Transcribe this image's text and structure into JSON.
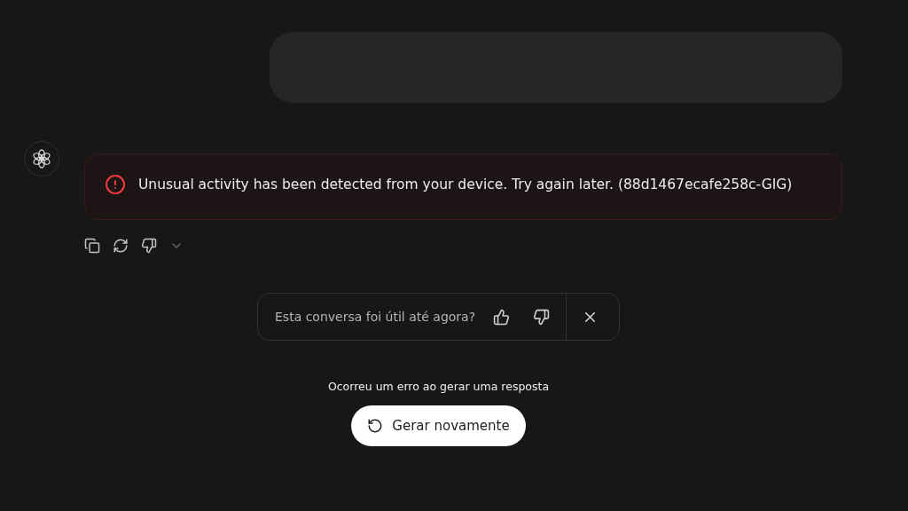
{
  "error_message": {
    "text": "Unusual activity has been detected from your device. Try again later. (88d1467ecafe258c-GIG)"
  },
  "feedback": {
    "question": "Esta conversa foi útil até agora?"
  },
  "status": {
    "text": "Ocorreu um erro ao gerar uma resposta"
  },
  "regenerate_button": {
    "label": "Gerar novamente"
  }
}
